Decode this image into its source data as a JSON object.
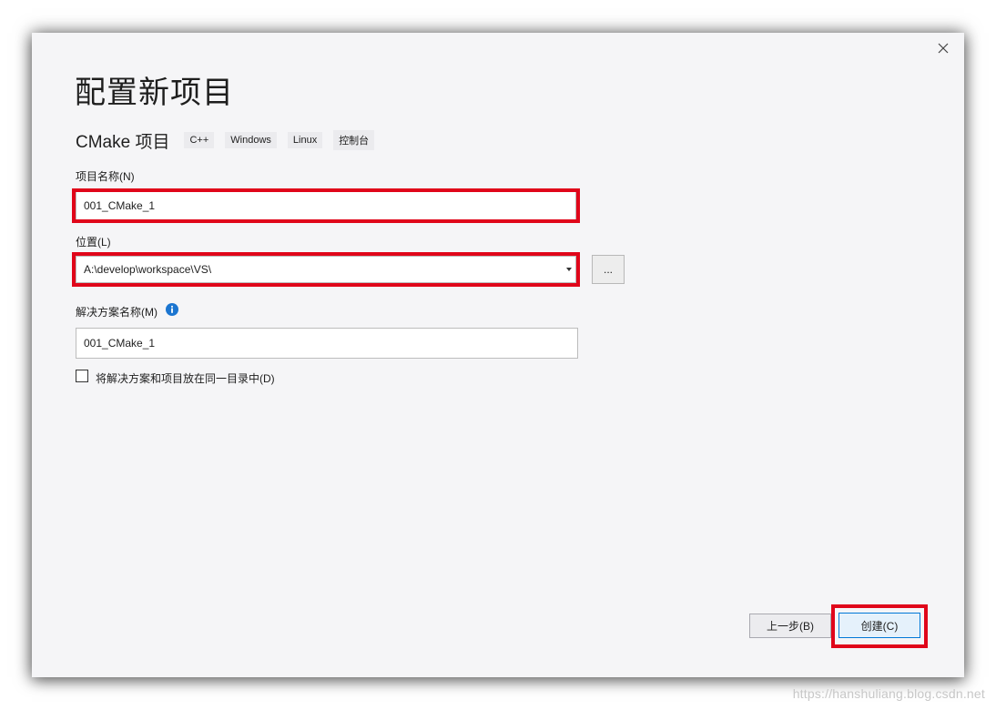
{
  "dialog": {
    "title": "配置新项目",
    "close_icon": "close-icon"
  },
  "template": {
    "name": "CMake 项目",
    "tags": [
      "C++",
      "Windows",
      "Linux",
      "控制台"
    ]
  },
  "project_name": {
    "label": "项目名称(N)",
    "value": "001_CMake_1"
  },
  "location": {
    "label": "位置(L)",
    "value": "A:\\develop\\workspace\\VS\\",
    "browse_label": "..."
  },
  "solution_name": {
    "label": "解决方案名称(M)",
    "value": "001_CMake_1",
    "info_icon": "info-icon"
  },
  "same_dir": {
    "label": "将解决方案和项目放在同一目录中(D)",
    "checked": false
  },
  "footer": {
    "back_label": "上一步(B)",
    "create_label": "创建(C)"
  },
  "watermark": "https://hanshuliang.blog.csdn.net",
  "colors": {
    "accent": "#0078d7",
    "highlight": "#e0061a",
    "info": "#1b75d0",
    "dialog_bg": "#f5f5f7"
  }
}
